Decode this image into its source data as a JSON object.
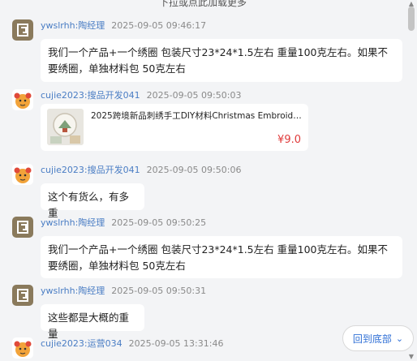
{
  "load_more": "下拉或点此加载更多",
  "messages": [
    {
      "avatar": "logo-avatar",
      "sender": "ywslrhh:陶经理",
      "time": "2025-09-05 09:46:17",
      "text": "我们一个产品+一个绣圈 包装尺寸23*24*1.5左右 重量100克左右。如果不要绣圈，单独材料包 50克左右"
    },
    {
      "avatar": "cartoon-avatar",
      "sender": "cujie2023:搜品开发041",
      "time": "2025-09-05 09:50:03",
      "product": {
        "title": "2025跨境新品刺绣手工DIY材料Christmas Embroider...",
        "price": "¥9.0"
      }
    },
    {
      "avatar": "cartoon-avatar",
      "sender": "cujie2023:搜品开发041",
      "time": "2025-09-05 09:50:06",
      "text": "这个有货么，有多重"
    },
    {
      "avatar": "logo-avatar",
      "sender": "ywslrhh:陶经理",
      "time": "2025-09-05 09:50:25",
      "text": "我们一个产品+一个绣圈 包装尺寸23*24*1.5左右 重量100克左右。如果不要绣圈，单独材料包 50克左右"
    },
    {
      "avatar": "logo-avatar",
      "sender": "ywslrhh:陶经理",
      "time": "2025-09-05 09:50:31",
      "text": "这些都是大概的重量"
    },
    {
      "avatar": "cartoon-avatar",
      "sender": "cujie2023:运营034",
      "time": "2025-09-05 13:31:46"
    }
  ],
  "scroll_bottom_label": "回到底部",
  "colors": {
    "sender": "#4a7dc4",
    "price": "#e03a3a",
    "accent": "#2f6fd6"
  }
}
